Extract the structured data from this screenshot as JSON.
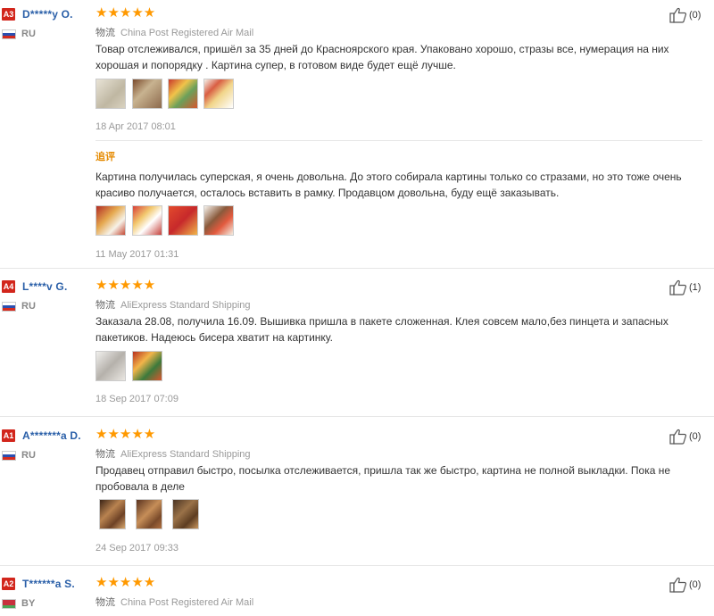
{
  "reviews": [
    {
      "badge": "A3",
      "user": "D*****y O.",
      "country": "RU",
      "flag": "ru",
      "stars": "★★★★★",
      "shipping_label": "物流",
      "shipping": "China Post Registered Air Mail",
      "text": "Товар отслеживался, пришёл за 35 дней до Красноярского края. Упаковано хорошо, стразы все, нумерация на них хорошая и попорядку . Картина супер, в готовом виде будет ещё лучше.",
      "date": "18 Apr 2017 08:01",
      "helpful": "(0)",
      "additional": {
        "label": "追评",
        "text": "Картина получилась суперская, я очень довольна. До этого собирала картины только со стразами, но это тоже очень красиво получается, осталось вставить в рамку. Продавцом довольна, буду ещё заказывать.",
        "date": "11 May 2017 01:31"
      }
    },
    {
      "badge": "A4",
      "user": "L****v G.",
      "country": "RU",
      "flag": "ru",
      "stars": "★★★★★",
      "shipping_label": "物流",
      "shipping": "AliExpress Standard Shipping",
      "text": "Заказала 28.08, получила 16.09. Вышивка пришла в пакете сложенная. Клея совсем мало,без пинцета и запасных пакетиков. Надеюсь бисера хватит на картинку.",
      "date": "18 Sep 2017 07:09",
      "helpful": "(1)"
    },
    {
      "badge": "A1",
      "user": "A*******a D.",
      "country": "RU",
      "flag": "ru",
      "stars": "★★★★★",
      "shipping_label": "物流",
      "shipping": "AliExpress Standard Shipping",
      "text": "Продавец отправил быстро, посылка отслеживается, пришла так же быстро, картина не полной выкладки. Пока не пробовала в деле",
      "date": "24 Sep 2017 09:33",
      "helpful": "(0)"
    },
    {
      "badge": "A2",
      "user": "T******a S.",
      "country": "BY",
      "flag": "by",
      "stars": "★★★★★",
      "shipping_label": "物流",
      "shipping": "China Post Registered Air Mail",
      "helpful": "(0)"
    }
  ]
}
